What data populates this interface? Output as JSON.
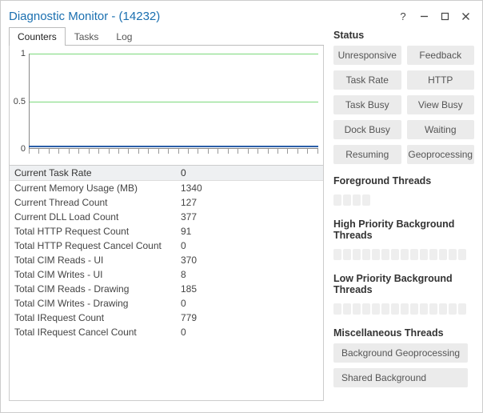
{
  "window": {
    "title": "Diagnostic Monitor - (14232)"
  },
  "tabs": {
    "t0": "Counters",
    "t1": "Tasks",
    "t2": "Log"
  },
  "chart_data": {
    "type": "line",
    "title": "",
    "xlabel": "",
    "ylabel": "",
    "ylim": [
      0,
      1
    ],
    "yticks": {
      "a": "1",
      "b": "0.5",
      "c": "0"
    },
    "series": [
      {
        "name": "Current Task Rate",
        "values": [
          0,
          0,
          0,
          0,
          0,
          0,
          0,
          0,
          0,
          0,
          0,
          0,
          0,
          0,
          0,
          0,
          0,
          0,
          0,
          0,
          0,
          0,
          0,
          0,
          0,
          0,
          0,
          0,
          0,
          0
        ]
      }
    ]
  },
  "counters": {
    "header_label": "Current Task Rate",
    "header_value": "0",
    "rows": {
      "r0": {
        "k": "Current Memory Usage (MB)",
        "v": "1340"
      },
      "r1": {
        "k": "Current Thread Count",
        "v": "127"
      },
      "r2": {
        "k": "Current DLL Load Count",
        "v": "377"
      },
      "r3": {
        "k": "Total HTTP Request Count",
        "v": "91"
      },
      "r4": {
        "k": "Total HTTP Request Cancel Count",
        "v": "0"
      },
      "r5": {
        "k": "Total CIM Reads - UI",
        "v": "370"
      },
      "r6": {
        "k": "Total CIM Writes - UI",
        "v": "8"
      },
      "r7": {
        "k": "Total CIM Reads - Drawing",
        "v": "185"
      },
      "r8": {
        "k": "Total CIM Writes - Drawing",
        "v": "0"
      },
      "r9": {
        "k": "Total IRequest Count",
        "v": "779"
      },
      "r10": {
        "k": "Total IRequest Cancel Count",
        "v": "0"
      }
    }
  },
  "status": {
    "title": "Status",
    "b0": "Unresponsive",
    "b1": "Feedback",
    "b2": "Task Rate",
    "b3": "HTTP",
    "b4": "Task Busy",
    "b5": "View Busy",
    "b6": "Dock Busy",
    "b7": "Waiting",
    "b8": "Resuming",
    "b9": "Geoprocessing"
  },
  "threads": {
    "fg_title": "Foreground Threads",
    "hp_title": "High Priority Background Threads",
    "lp_title": "Low Priority Background Threads",
    "misc_title": "Miscellaneous Threads",
    "misc_b0": "Background Geoprocessing",
    "misc_b1": "Shared Background"
  }
}
